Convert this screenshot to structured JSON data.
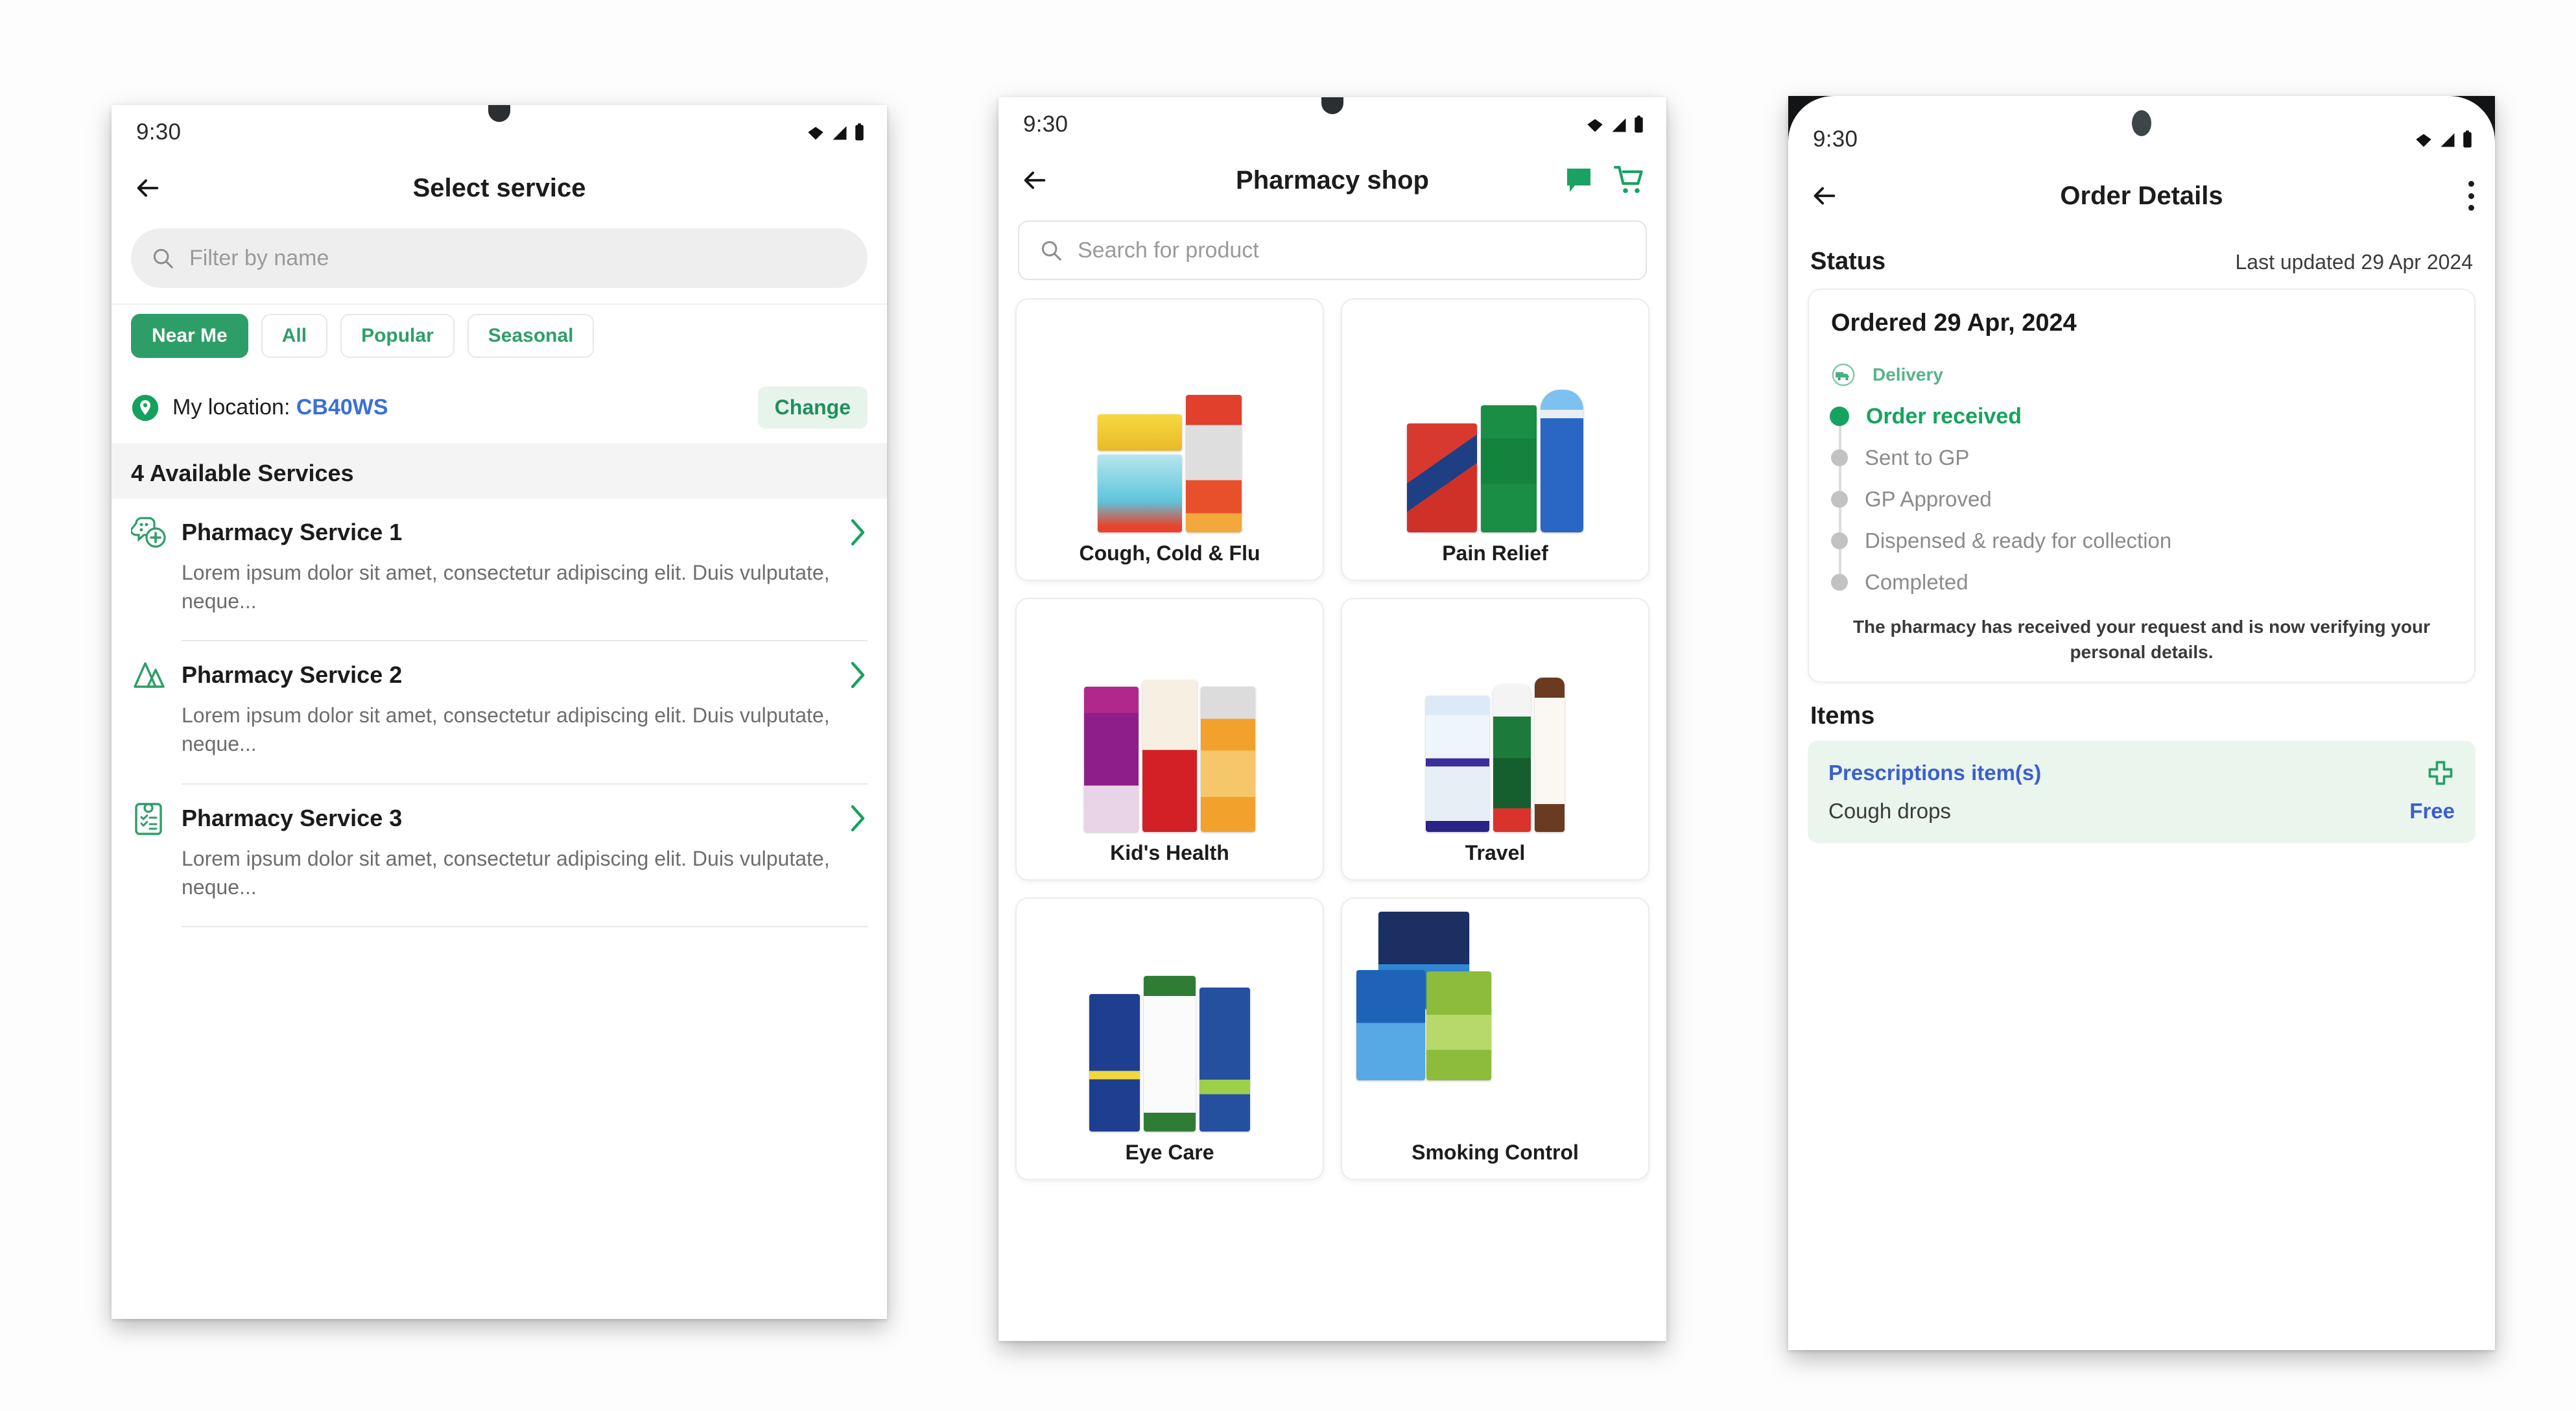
{
  "theme": {
    "brand_green": "#2e9e68",
    "accent_green": "#16a35f",
    "link_blue": "#3a5fd0",
    "location_blue": "#3a6fd8",
    "muted_grey": "#8b8b8b",
    "card_grey": "#f4f4f4"
  },
  "phone1": {
    "statusbar": {
      "time": "9:30",
      "wifi_icon": "wifi-icon",
      "signal_icon": "signal-icon",
      "battery_icon": "battery-icon"
    },
    "appbar": {
      "back_icon": "back-arrow-icon",
      "title": "Select service"
    },
    "search": {
      "icon": "search-icon",
      "placeholder": "Filter by name",
      "value": ""
    },
    "chips": [
      {
        "label": "Near Me",
        "active": true
      },
      {
        "label": "All",
        "active": false
      },
      {
        "label": "Popular",
        "active": false
      },
      {
        "label": "Seasonal",
        "active": false
      }
    ],
    "location": {
      "pin_icon": "location-pin-icon",
      "label": "My location:",
      "code": "CB40WS",
      "change_label": "Change"
    },
    "section_title": "4 Available Services",
    "services": [
      {
        "icon": "pharmacy-consultation-icon",
        "name": "Pharmacy Service 1",
        "desc": "Lorem ipsum dolor sit amet, consectetur adipiscing elit. Duis vulputate, neque...",
        "chevron_icon": "chevron-right-icon"
      },
      {
        "icon": "mountains-icon",
        "name": "Pharmacy Service 2",
        "desc": "Lorem ipsum dolor sit amet, consectetur adipiscing elit. Duis vulputate, neque...",
        "chevron_icon": "chevron-right-icon"
      },
      {
        "icon": "clipboard-checklist-icon",
        "name": "Pharmacy Service 3",
        "desc": "Lorem ipsum dolor sit amet, consectetur adipiscing elit. Duis vulputate, neque...",
        "chevron_icon": "chevron-right-icon"
      }
    ]
  },
  "phone2": {
    "statusbar": {
      "time": "9:30",
      "wifi_icon": "wifi-icon",
      "signal_icon": "signal-icon",
      "battery_icon": "battery-icon"
    },
    "appbar": {
      "back_icon": "back-arrow-icon",
      "title": "Pharmacy shop",
      "chat_icon": "chat-bubble-icon",
      "cart_icon": "shopping-cart-icon"
    },
    "search": {
      "icon": "search-icon",
      "placeholder": "Search for product",
      "value": ""
    },
    "categories": [
      {
        "name": "Cough, Cold & Flu",
        "image": "cough-cold-flu-products-image"
      },
      {
        "name": "Pain Relief",
        "image": "pain-relief-products-image"
      },
      {
        "name": "Kid's Health",
        "image": "kids-health-products-image"
      },
      {
        "name": "Travel",
        "image": "travel-products-image"
      },
      {
        "name": "Eye Care",
        "image": "eye-care-products-image"
      },
      {
        "name": "Smoking Control",
        "image": "smoking-control-products-image"
      }
    ]
  },
  "phone3": {
    "statusbar": {
      "time": "9:30",
      "wifi_icon": "wifi-icon",
      "signal_icon": "signal-icon",
      "battery_icon": "battery-icon"
    },
    "appbar": {
      "back_icon": "back-arrow-icon",
      "title": "Order Details",
      "menu_icon": "kebab-menu-icon"
    },
    "status": {
      "label": "Status",
      "last_updated": "Last updated 29 Apr 2024"
    },
    "timeline": {
      "title": "Ordered 29 Apr, 2024",
      "delivery": {
        "icon": "delivery-truck-icon",
        "label": "Delivery"
      },
      "steps": [
        {
          "label": "Order received",
          "done": true
        },
        {
          "label": "Sent to GP",
          "done": false
        },
        {
          "label": "GP Approved",
          "done": false
        },
        {
          "label": "Dispensed & ready for collection",
          "done": false
        },
        {
          "label": "Completed",
          "done": false
        }
      ],
      "note": "The pharmacy has received your request and is now verifying your personal details."
    },
    "items": {
      "heading": "Items",
      "prescriptions_label": "Prescriptions item(s)",
      "plus_icon": "pharmacy-cross-icon",
      "rows": [
        {
          "name": "Cough drops",
          "price": "Free"
        }
      ]
    }
  }
}
